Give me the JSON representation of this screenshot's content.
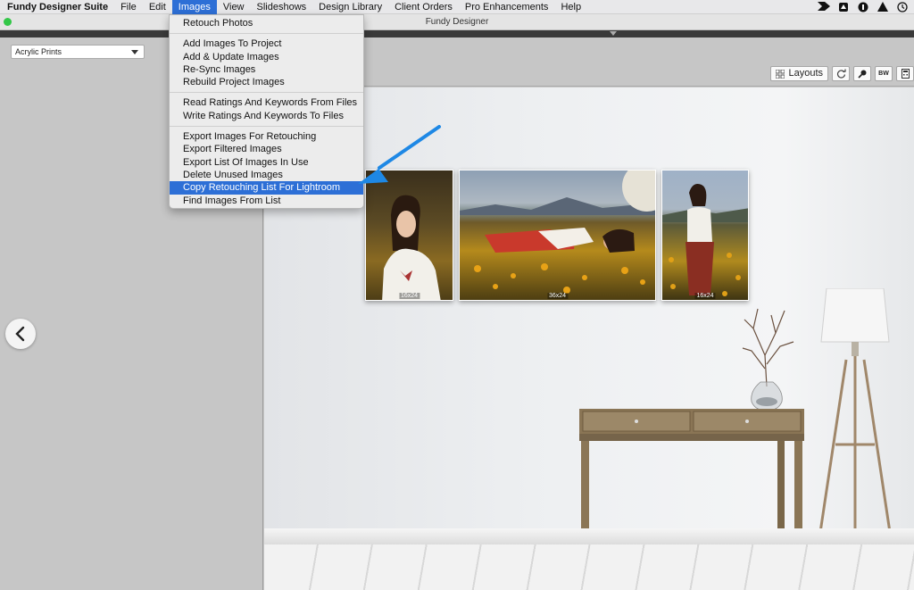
{
  "menubar": {
    "app_name": "Fundy Designer Suite",
    "menus": [
      "File",
      "Edit",
      "Images",
      "View",
      "Slideshows",
      "Design Library",
      "Client Orders",
      "Pro Enhancements",
      "Help"
    ],
    "active_menu": "Images",
    "tray_icons": [
      "fundy-tray-icon",
      "dropbox-icon",
      "accessibility-icon",
      "warning-icon",
      "time-machine-icon"
    ]
  },
  "window": {
    "title": "Fundy Designer"
  },
  "left_panel": {
    "product_select": "Acrylic Prints"
  },
  "toolbar": {
    "layouts_label": "Layouts",
    "bw_label": "BW"
  },
  "images_menu": {
    "groups": [
      [
        "Retouch Photos"
      ],
      [
        "Add Images To Project",
        "Add & Update Images",
        "Re-Sync Images",
        "Rebuild Project Images"
      ],
      [
        "Read Ratings And Keywords From Files",
        "Write Ratings And Keywords To Files"
      ],
      [
        "Export Images For Retouching",
        "Export Filtered Images",
        "Export List Of Images In Use",
        "Delete Unused Images",
        "Copy Retouching List For Lightroom",
        "Find Images From List"
      ]
    ],
    "highlighted": "Copy Retouching List For Lightroom"
  },
  "wall": {
    "prints": [
      {
        "size": "16x24"
      },
      {
        "size": "36x24"
      },
      {
        "size": "16x24"
      }
    ]
  },
  "colors": {
    "menu_highlight": "#2d6fd6",
    "annotation_arrow": "#1e88e5",
    "status_green": "#33c748"
  }
}
